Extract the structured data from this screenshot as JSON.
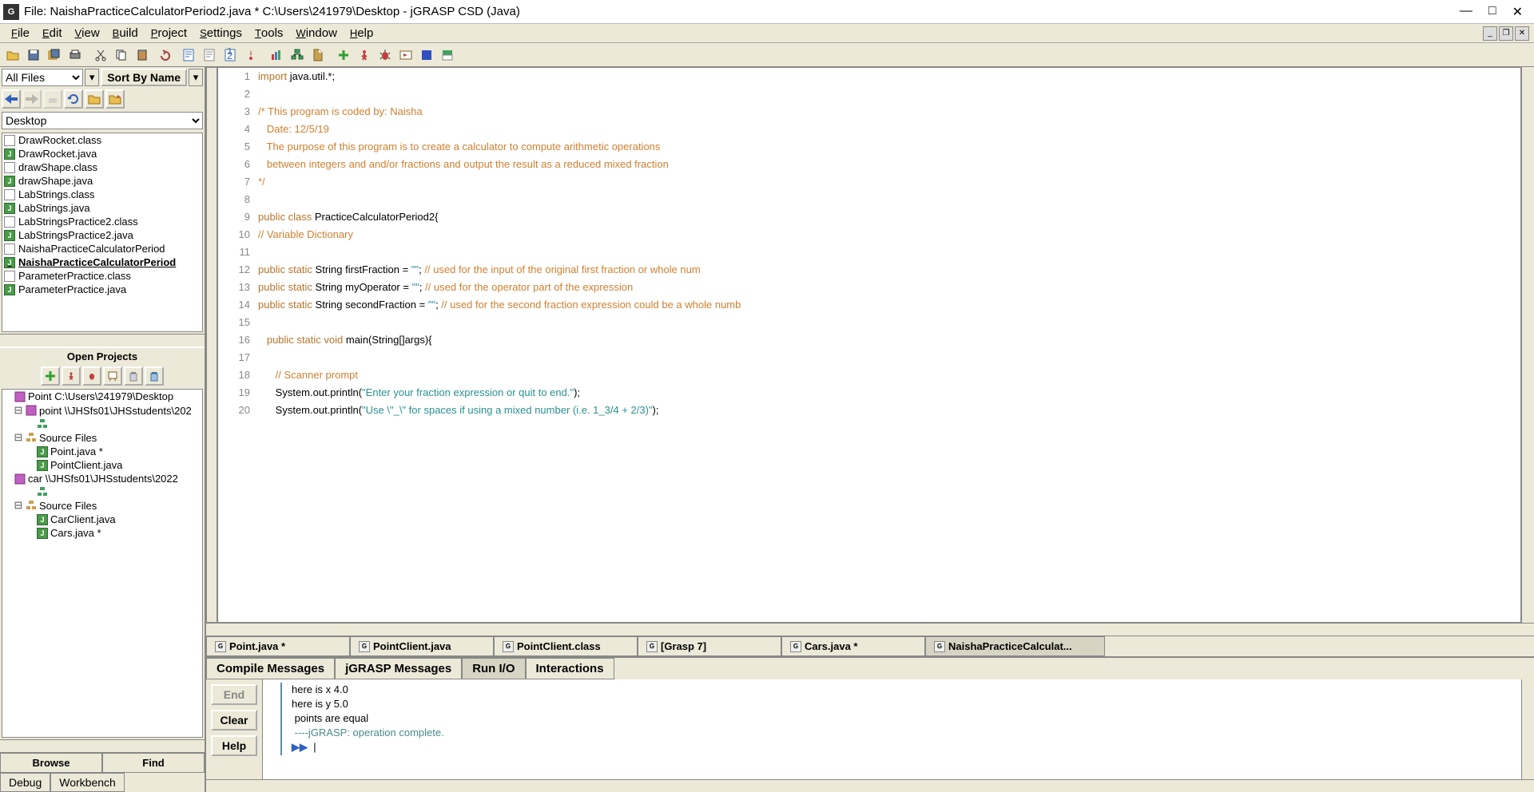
{
  "title": "File: NaishaPracticeCalculatorPeriod2.java *  C:\\Users\\241979\\Desktop - jGRASP CSD (Java)",
  "menu": [
    "File",
    "Edit",
    "View",
    "Build",
    "Project",
    "Settings",
    "Tools",
    "Window",
    "Help"
  ],
  "filter": "All Files",
  "sort": "Sort By Name",
  "path": "Desktop",
  "files": [
    {
      "name": "DrawRocket.class",
      "type": "c"
    },
    {
      "name": "DrawRocket.java",
      "type": "j"
    },
    {
      "name": "drawShape.class",
      "type": "c"
    },
    {
      "name": "drawShape.java",
      "type": "j"
    },
    {
      "name": "LabStrings.class",
      "type": "c"
    },
    {
      "name": "LabStrings.java",
      "type": "j"
    },
    {
      "name": "LabStringsPractice2.class",
      "type": "c"
    },
    {
      "name": "LabStringsPractice2.java",
      "type": "j"
    },
    {
      "name": "NaishaPracticeCalculatorPeriod",
      "type": "c"
    },
    {
      "name": "NaishaPracticeCalculatorPeriod",
      "type": "j",
      "sel": true
    },
    {
      "name": "ParameterPractice.class",
      "type": "c"
    },
    {
      "name": "ParameterPractice.java",
      "type": "j"
    }
  ],
  "openProjectsLabel": "Open Projects",
  "projects": [
    {
      "name": "Point  C:\\Users\\241979\\Desktop",
      "children": [
        "point  \\\\JHSfs01\\JHSstudents\\202"
      ],
      "uml": "<UML>",
      "src": "Source Files",
      "files": [
        "Point.java *",
        "PointClient.java"
      ]
    },
    {
      "name": "car  \\\\JHSfs01\\JHSstudents\\2022",
      "children": [],
      "uml": "<UML>",
      "src": "Source Files",
      "files": [
        "CarClient.java",
        "Cars.java *"
      ]
    }
  ],
  "browseTab": "Browse",
  "findTab": "Find",
  "debugTab": "Debug",
  "workbenchTab": "Workbench",
  "code": [
    {
      "n": 1,
      "h": "<span class='kw'>import</span> java.util.*;"
    },
    {
      "n": 2,
      "h": ""
    },
    {
      "n": 3,
      "h": "<span class='cm'>/* This program is coded by: Naisha</span>"
    },
    {
      "n": 4,
      "h": "<span class='cm'>   Date: 12/5/19</span>"
    },
    {
      "n": 5,
      "h": "<span class='cm'>   The purpose of this program is to create a calculator to compute arithmetic operations</span>"
    },
    {
      "n": 6,
      "h": "<span class='cm'>   between integers and and/or fractions and output the result as a reduced mixed fraction</span>"
    },
    {
      "n": 7,
      "h": "<span class='cm'>*/</span>"
    },
    {
      "n": 8,
      "h": ""
    },
    {
      "n": 9,
      "h": "<span class='kw'>public</span> <span class='kw'>class</span> PracticeCalculatorPeriod2{"
    },
    {
      "n": 10,
      "h": "<span class='cm'>// Variable Dictionary</span>"
    },
    {
      "n": 11,
      "h": ""
    },
    {
      "n": 12,
      "h": "<span class='kw'>public</span> <span class='kw'>static</span> String firstFraction = <span class='str'>\"\"</span>; <span class='cm'>// used for the input of the original first fraction or whole num</span>"
    },
    {
      "n": 13,
      "h": "<span class='kw'>public</span> <span class='kw'>static</span> String myOperator = <span class='str'>\"\"</span>; <span class='cm'>// used for the operator part of the expression</span>"
    },
    {
      "n": 14,
      "h": "<span class='kw'>public</span> <span class='kw'>static</span> String secondFraction = <span class='str'>\"\"</span>; <span class='cm'>// used for the second fraction expression could be a whole numb</span>"
    },
    {
      "n": 15,
      "h": ""
    },
    {
      "n": 16,
      "h": "   <span class='kw'>public</span> <span class='kw'>static</span> <span class='kw'>void</span> main(String[]args){"
    },
    {
      "n": 17,
      "h": ""
    },
    {
      "n": 18,
      "h": "      <span class='cm'>// Scanner prompt</span>"
    },
    {
      "n": 19,
      "h": "      System.out.println(<span class='str'>\"Enter your fraction expression or quit to end.\"</span>);"
    },
    {
      "n": 20,
      "h": "      System.out.println(<span class='str'>\"Use \\\"_\\\" for spaces if using a mixed number (i.e. 1_3/4 + 2/3)\"</span>);"
    }
  ],
  "editorTabs": [
    "Point.java *",
    "PointClient.java",
    "PointClient.class",
    "[Grasp 7]",
    "Cars.java *",
    "NaishaPracticeCalculat..."
  ],
  "activeEditorTab": 5,
  "consoleTabs": [
    "Compile Messages",
    "jGRASP Messages",
    "Run I/O",
    "Interactions"
  ],
  "activeConsoleTab": 2,
  "consoleButtons": {
    "end": "End",
    "clear": "Clear",
    "help": "Help"
  },
  "consoleOut": [
    "here is x 4.0",
    "here is y 5.0",
    " points are equal",
    ""
  ],
  "consoleDone": " ----jGRASP: operation complete.",
  "prompt": "▶▶"
}
